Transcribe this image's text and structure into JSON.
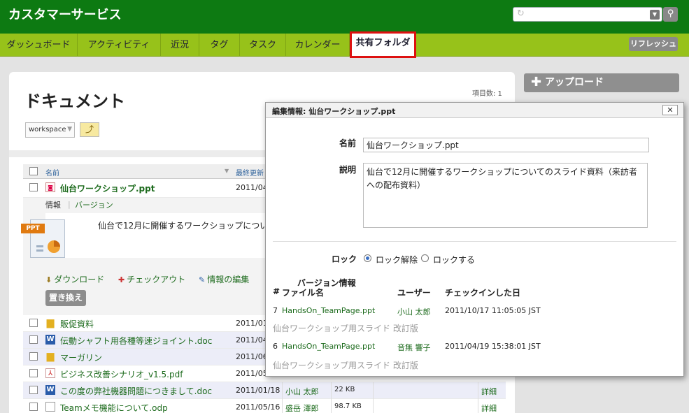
{
  "header": {
    "app_title": "カスタマーサービス"
  },
  "nav": {
    "tabs": [
      {
        "label": "ダッシュボード"
      },
      {
        "label": "アクティビティ"
      },
      {
        "label": "近況"
      },
      {
        "label": "タグ"
      },
      {
        "label": "タスク"
      },
      {
        "label": "カレンダー"
      },
      {
        "label": "共有フォルダ",
        "active": true
      }
    ],
    "refresh_label": "リフレッシュ"
  },
  "main": {
    "title": "ドキュメント",
    "item_count": "項目数: 1",
    "workspace": "workspace",
    "columns": {
      "name": "名前",
      "updated": "最終更新"
    },
    "expanded_file": {
      "name": "仙台ワークショップ.ppt",
      "date": "2011/04",
      "tab_info": "情報",
      "tab_version": "バージョン",
      "thumb_badge": "PPT",
      "description": "仙台で12月に開催するワークショップについ",
      "actions": {
        "download": "ダウンロード",
        "checkout": "チェックアウト",
        "edit_info": "情報の編集"
      },
      "replace": "置き換え"
    },
    "files": [
      {
        "name": "販促資料",
        "date": "2011/01",
        "user": "",
        "size": "",
        "detail": "",
        "type": "folder"
      },
      {
        "name": "伝動シャフト用各種等速ジョイント.doc",
        "date": "2011/04",
        "user": "",
        "size": "",
        "detail": "",
        "type": "word"
      },
      {
        "name": "マーガリン",
        "date": "2011/06",
        "user": "",
        "size": "",
        "detail": "",
        "type": "folder"
      },
      {
        "name": "ビジネス改善シナリオ_v1.5.pdf",
        "date": "2011/05",
        "user": "",
        "size": "",
        "detail": "",
        "type": "pdf"
      },
      {
        "name": "この度の弊社機器問題につきまして.doc",
        "date": "2011/01/18",
        "user": "小山 太郎",
        "size": "22 KB",
        "detail": "詳細",
        "type": "word"
      },
      {
        "name": "Teamメモ機能について.odp",
        "date": "2011/05/16",
        "user": "盛岳 澤郎",
        "size": "98.7 KB",
        "detail": "詳細",
        "type": "doc"
      }
    ]
  },
  "sidebar": {
    "upload_label": "アップロード"
  },
  "dialog": {
    "title": "編集情報: 仙台ワークショップ.ppt",
    "close": "✕",
    "name_label": "名前",
    "name_value": "仙台ワークショップ.ppt",
    "desc_label": "説明",
    "desc_value": "仙台で12月に開催するワークショップについてのスライド資料（来訪者への配布資料）",
    "lock_label": "ロック",
    "lock_options": [
      "ロック解除",
      "ロックする"
    ],
    "version_label": "バージョン情報",
    "version_cols": {
      "num": "#",
      "file": "ファイル名",
      "user": "ユーザー",
      "checked_in": "チェックインした日"
    },
    "versions": [
      {
        "num": "7",
        "file": "HandsOn_TeamPage.ppt",
        "user": "小山 太郎",
        "date": "2011/10/17 11:05:05 JST",
        "note": "仙台ワークショップ用スライド 改訂版"
      },
      {
        "num": "6",
        "file": "HandsOn_TeamPage.ppt",
        "user": "音無 響子",
        "date": "2011/04/19 15:38:01 JST",
        "note": "仙台ワークショップ用スライド 改訂版"
      }
    ]
  }
}
